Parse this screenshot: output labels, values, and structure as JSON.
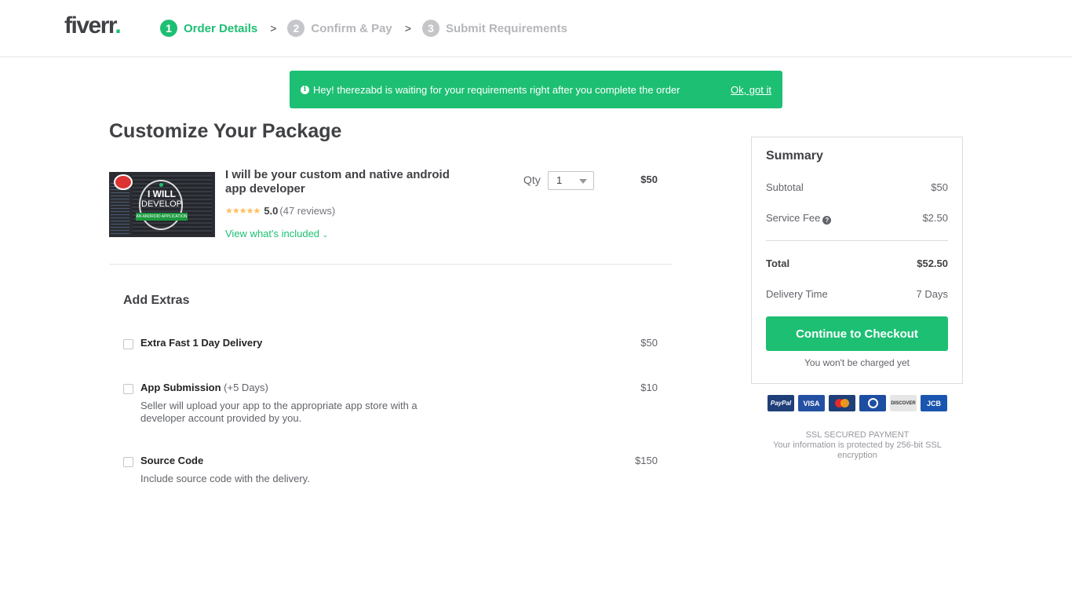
{
  "header": {
    "logo": "fiverr",
    "logo_dot": ".",
    "steps": [
      {
        "num": "1",
        "label": "Order Details",
        "state": "active"
      },
      {
        "num": "2",
        "label": "Confirm & Pay",
        "state": "inactive"
      },
      {
        "num": "3",
        "label": "Submit Requirements",
        "state": "inactive"
      }
    ],
    "separator": ">"
  },
  "banner": {
    "icon": "info-icon",
    "icon_glyph": "i",
    "message": "Hey! therezabd is waiting for your requirements right after you complete the order",
    "action": "Ok, got it"
  },
  "main": {
    "title": "Customize Your Package",
    "gig": {
      "thumbnail_text_1": "I WILL",
      "thumbnail_text_2": "DEVELOP",
      "thumbnail_ribbon": "AN ANDROID APPLICATION",
      "title": "I will be your custom and native android app developer",
      "stars": "★★★★★",
      "rating": "5.0",
      "reviews": "(47 reviews)",
      "view_included": "View what's included",
      "view_included_chevron": "⌄",
      "qty_label": "Qty",
      "qty_value": "1",
      "price": "$50"
    },
    "extras": {
      "title": "Add Extras",
      "items": [
        {
          "name": "Extra Fast 1 Day Delivery",
          "suffix": "",
          "description": "",
          "price": "$50",
          "checked": false
        },
        {
          "name": "App Submission",
          "suffix": " (+5 Days)",
          "description": "Seller will upload your app to the appropriate app store with a developer account provided by you.",
          "price": "$10",
          "checked": false
        },
        {
          "name": "Source Code",
          "suffix": "",
          "description": "Include source code with the delivery.",
          "price": "$150",
          "checked": false
        }
      ]
    }
  },
  "summary": {
    "title": "Summary",
    "subtotal_label": "Subtotal",
    "subtotal_value": "$50",
    "service_fee_label": "Service Fee",
    "service_fee_help": "?",
    "service_fee_value": "$2.50",
    "total_label": "Total",
    "total_value": "$52.50",
    "delivery_label": "Delivery Time",
    "delivery_value": "7 Days",
    "checkout_button": "Continue to Checkout",
    "not_charged": "You won't be charged yet"
  },
  "payments": {
    "methods": [
      "PayPal",
      "VISA",
      "MasterCard",
      "Diners Club",
      "DISCOVER",
      "JCB"
    ]
  },
  "ssl": {
    "title": "SSL SECURED PAYMENT",
    "text": "Your information is protected by 256-bit SSL encryption"
  },
  "colors": {
    "accent": "#1dbf73",
    "text": "#404145",
    "muted": "#62646a",
    "star": "#ffbe5b"
  }
}
